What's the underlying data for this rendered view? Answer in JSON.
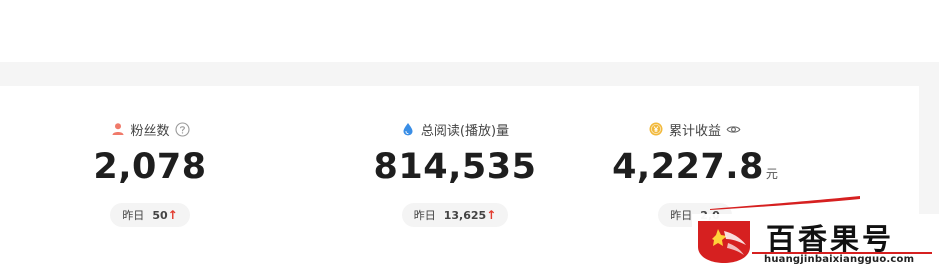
{
  "stats": {
    "fans": {
      "label": "粉丝数",
      "value": "2,078",
      "yesterday_label": "昨日",
      "yesterday_value": "50",
      "trend": "up"
    },
    "reads": {
      "label": "总阅读(播放)量",
      "value": "814,535",
      "yesterday_label": "昨日",
      "yesterday_value": "13,625",
      "trend": "up"
    },
    "income": {
      "label": "累计收益",
      "value": "4,227.8",
      "unit": "元",
      "yesterday_label": "昨日",
      "yesterday_value": "2,0",
      "trend": "up"
    }
  },
  "icons": {
    "fans": "person-icon",
    "reads": "droplet-icon",
    "income": "coin-icon",
    "help": "question-circle-icon",
    "visibility": "eye-icon",
    "trend": "arrow-up-icon"
  },
  "colors": {
    "person": "#f07a6a",
    "droplet": "#3a8ee6",
    "coin": "#f2b93b",
    "up_arrow": "#e23b2e",
    "brand_red": "#d62020"
  },
  "watermark": {
    "title": "百香果号",
    "url": "huangjinbaixiangguo.com"
  },
  "arrow_glyph": "↑"
}
